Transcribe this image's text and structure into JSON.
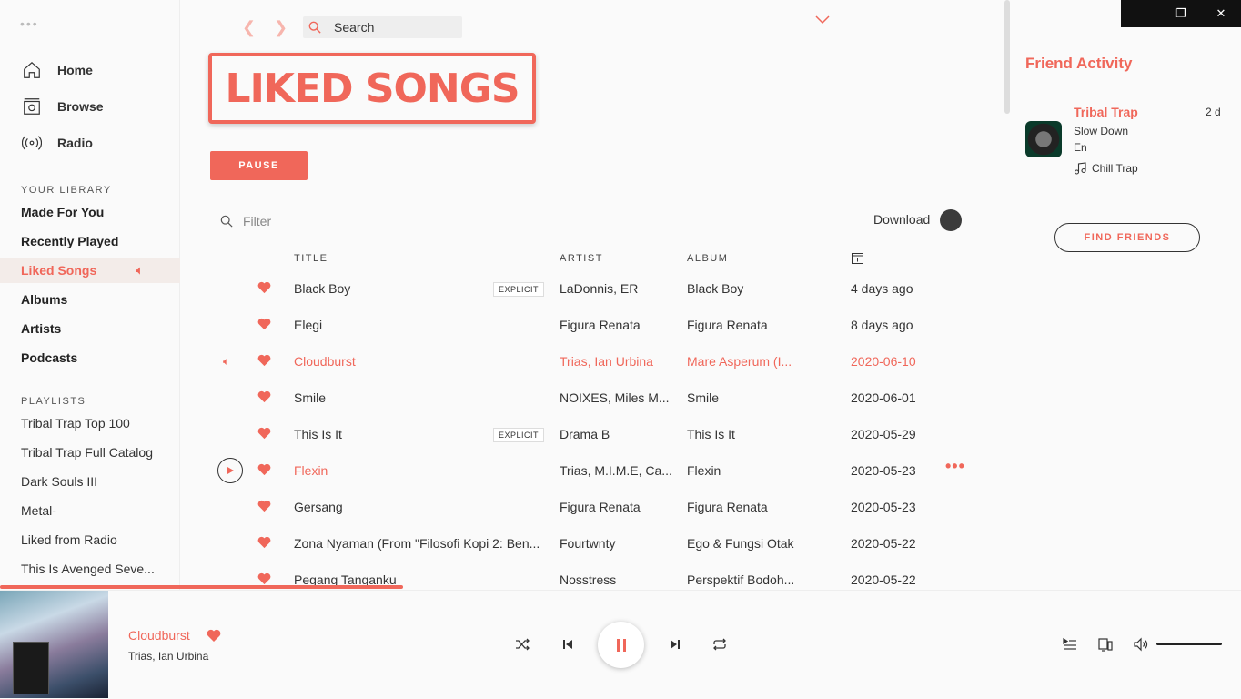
{
  "sidebar": {
    "dots": "•••",
    "nav": [
      {
        "label": "Home",
        "icon": "home-icon"
      },
      {
        "label": "Browse",
        "icon": "browse-icon"
      },
      {
        "label": "Radio",
        "icon": "radio-icon"
      }
    ],
    "library_title": "YOUR LIBRARY",
    "library": [
      "Made For You",
      "Recently Played",
      "Liked Songs",
      "Albums",
      "Artists",
      "Podcasts"
    ],
    "active_library": "Liked Songs",
    "playlists_title": "PLAYLISTS",
    "playlists": [
      "Tribal Trap Top 100",
      "Tribal Trap Full Catalog",
      "Dark Souls III",
      "Metal-",
      "Liked from Radio",
      "This Is Avenged Seve..."
    ]
  },
  "topbar": {
    "search_placeholder": "Search"
  },
  "page": {
    "title": "LIKED SONGS",
    "pause_label": "PAUSE",
    "filter_placeholder": "Filter",
    "download_label": "Download"
  },
  "table": {
    "headers": {
      "title": "TITLE",
      "artist": "ARTIST",
      "album": "ALBUM"
    },
    "explicit_label": "EXPLICIT",
    "rows": [
      {
        "title": "Black Boy",
        "explicit": true,
        "artist": "LaDonnis, ER",
        "album": "Black Boy",
        "added": "4 days ago"
      },
      {
        "title": "Elegi",
        "explicit": false,
        "artist": "Figura Renata",
        "album": "Figura Renata",
        "added": "8 days ago"
      },
      {
        "title": "Cloudburst",
        "explicit": false,
        "artist": "Trias, Ian Urbina",
        "album": "Mare Asperum (I...",
        "added": "2020-06-10",
        "playing": true
      },
      {
        "title": "Smile",
        "explicit": false,
        "artist": "NOIXES, Miles M...",
        "album": "Smile",
        "added": "2020-06-01"
      },
      {
        "title": "This Is It",
        "explicit": true,
        "artist": "Drama B",
        "album": "This Is It",
        "added": "2020-05-29"
      },
      {
        "title": "Flexin",
        "explicit": false,
        "artist": "Trias, M.I.M.E, Ca...",
        "album": "Flexin",
        "added": "2020-05-23",
        "hovered": true
      },
      {
        "title": "Gersang",
        "explicit": false,
        "artist": "Figura Renata",
        "album": "Figura Renata",
        "added": "2020-05-23"
      },
      {
        "title": "Zona Nyaman (From \"Filosofi Kopi 2: Ben...",
        "explicit": false,
        "artist": "Fourtwnty",
        "album": "Ego & Fungsi Otak",
        "added": "2020-05-22"
      },
      {
        "title": "Pegang Tanganku",
        "explicit": false,
        "artist": "Nosstress",
        "album": "Perspektif Bodoh...",
        "added": "2020-05-22"
      }
    ]
  },
  "friend_activity": {
    "title": "Friend Activity",
    "friend": {
      "name": "Tribal Trap",
      "time": "2 d",
      "track": "Slow Down",
      "artist": "En",
      "context": "Chill Trap"
    },
    "find_friends_label": "FIND FRIENDS"
  },
  "player": {
    "track": "Cloudburst",
    "artist": "Trias, Ian Urbina",
    "volume": 1.0
  },
  "colors": {
    "accent": "#f0675a",
    "background": "#fafafa"
  }
}
